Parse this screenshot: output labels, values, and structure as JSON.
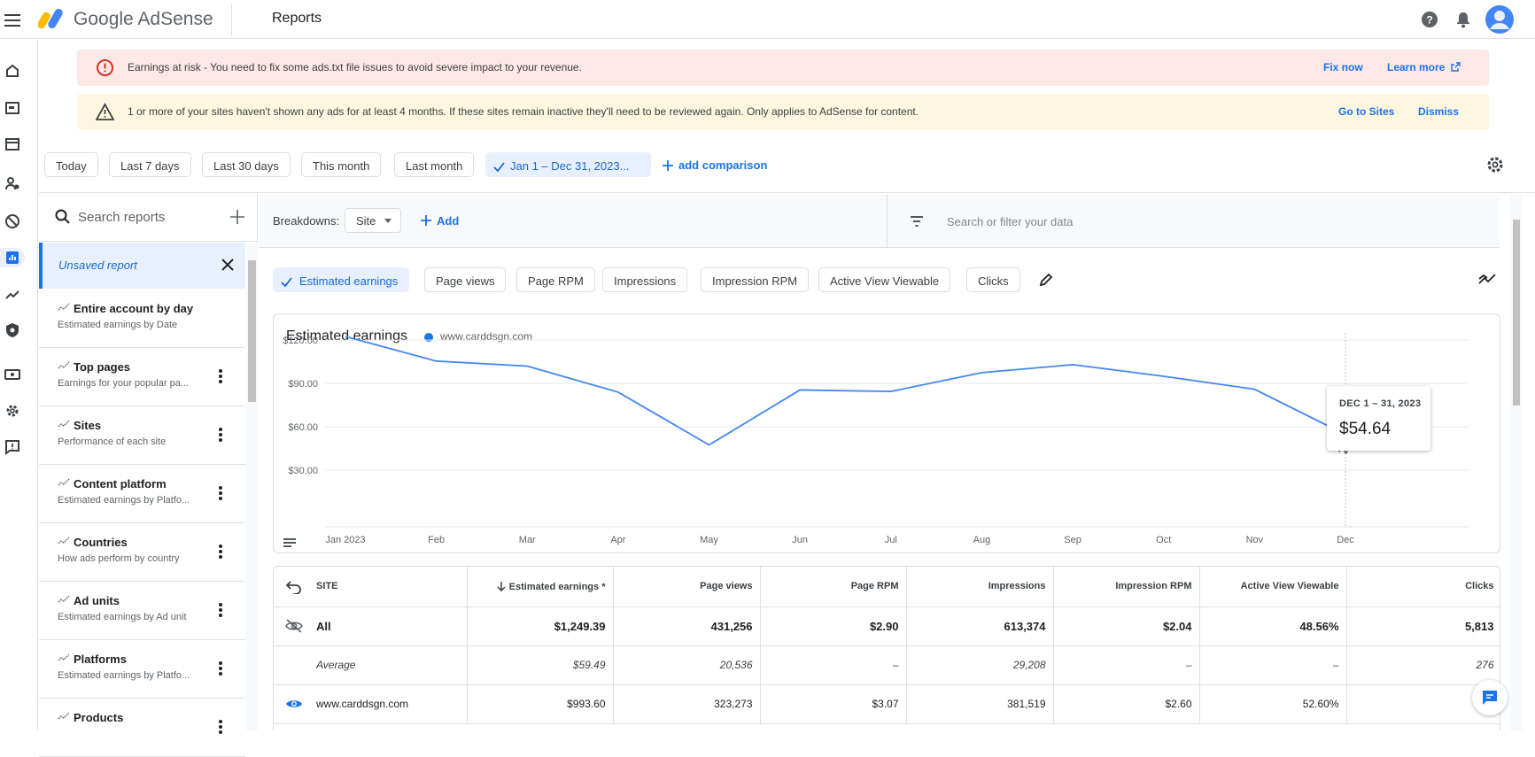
{
  "appbar": {
    "brand": "Google AdSense",
    "page_title": "Reports"
  },
  "banners": {
    "risk": {
      "text": "Earnings at risk - You need to fix some ads.txt file issues to avoid severe impact to your revenue.",
      "fix_now": "Fix now",
      "learn_more": "Learn more"
    },
    "inactive": {
      "text": "1 or more of your sites haven't shown any ads for at least 4 months. If these sites remain inactive they'll need to be reviewed again. Only applies to AdSense for content.",
      "go_to_sites": "Go to Sites",
      "dismiss": "Dismiss"
    }
  },
  "date_range": {
    "chips": [
      "Today",
      "Last 7 days",
      "Last 30 days",
      "This month",
      "Last month"
    ],
    "selected": "Jan 1 – Dec 31, 2023...",
    "add_comparison": "add comparison"
  },
  "reports_panel": {
    "search_placeholder": "Search reports",
    "unsaved": "Unsaved report",
    "items": [
      {
        "name": "Entire account by day",
        "desc": "Estimated earnings by Date"
      },
      {
        "name": "Top pages",
        "desc": "Earnings for your popular pa..."
      },
      {
        "name": "Sites",
        "desc": "Performance of each site"
      },
      {
        "name": "Content platform",
        "desc": "Estimated earnings by Platfo..."
      },
      {
        "name": "Countries",
        "desc": "How ads perform by country"
      },
      {
        "name": "Ad units",
        "desc": "Estimated earnings by Ad unit"
      },
      {
        "name": "Platforms",
        "desc": "Estimated earnings by Platfo..."
      },
      {
        "name": "Products",
        "desc": ""
      }
    ]
  },
  "breakdowns": {
    "label": "Breakdowns:",
    "selected": "Site",
    "add": "Add",
    "filter_placeholder": "Search or filter your data"
  },
  "metrics": {
    "chips": [
      "Estimated earnings",
      "Page views",
      "Page RPM",
      "Impressions",
      "Impression RPM",
      "Active View Viewable",
      "Clicks"
    ],
    "selected_index": 0
  },
  "chart": {
    "title": "Estimated earnings",
    "legend": "www.carddsgn.com",
    "tooltip_label": "DEC 1 – 31, 2023",
    "tooltip_value": "$54.64"
  },
  "chart_data": {
    "type": "line",
    "title": "Estimated earnings",
    "categories": [
      "Jan 2023",
      "Feb",
      "Mar",
      "Apr",
      "May",
      "Jun",
      "Jul",
      "Aug",
      "Sep",
      "Oct",
      "Nov",
      "Dec"
    ],
    "y_tick_labels": [
      "$30.00",
      "$60.00",
      "$90.00",
      "$120.00"
    ],
    "y_ticks": [
      30,
      60,
      90,
      120
    ],
    "ylim": [
      0,
      125
    ],
    "series": [
      {
        "name": "www.carddsgn.com",
        "values": [
          122.5,
          105.5,
          102,
          84,
          47.5,
          85.5,
          84.5,
          97.5,
          103,
          95,
          86,
          54.64
        ]
      }
    ],
    "grid": true,
    "color": "#4285f4"
  },
  "table": {
    "columns": [
      "SITE",
      "Estimated earnings *",
      "Page views",
      "Page RPM",
      "Impressions",
      "Impression RPM",
      "Active View Viewable",
      "Clicks"
    ],
    "rows": [
      {
        "kind": "total",
        "cells": [
          "All",
          "$1,249.39",
          "431,256",
          "$2.90",
          "613,374",
          "$2.04",
          "48.56%",
          "5,813"
        ]
      },
      {
        "kind": "avg",
        "cells": [
          "Average",
          "$59.49",
          "20,536",
          "–",
          "29,208",
          "–",
          "–",
          "276"
        ]
      },
      {
        "kind": "site",
        "cells": [
          "www.carddsgn.com",
          "$993.60",
          "323,273",
          "$3.07",
          "381,519",
          "$2.60",
          "52.60%",
          "2"
        ]
      }
    ]
  },
  "colors": {
    "accent": "#1a73e8",
    "selected_bg": "#e8f0fe",
    "error_bg": "#fce8e6",
    "warning_bg": "#fef7e0",
    "line": "#4285f4"
  }
}
